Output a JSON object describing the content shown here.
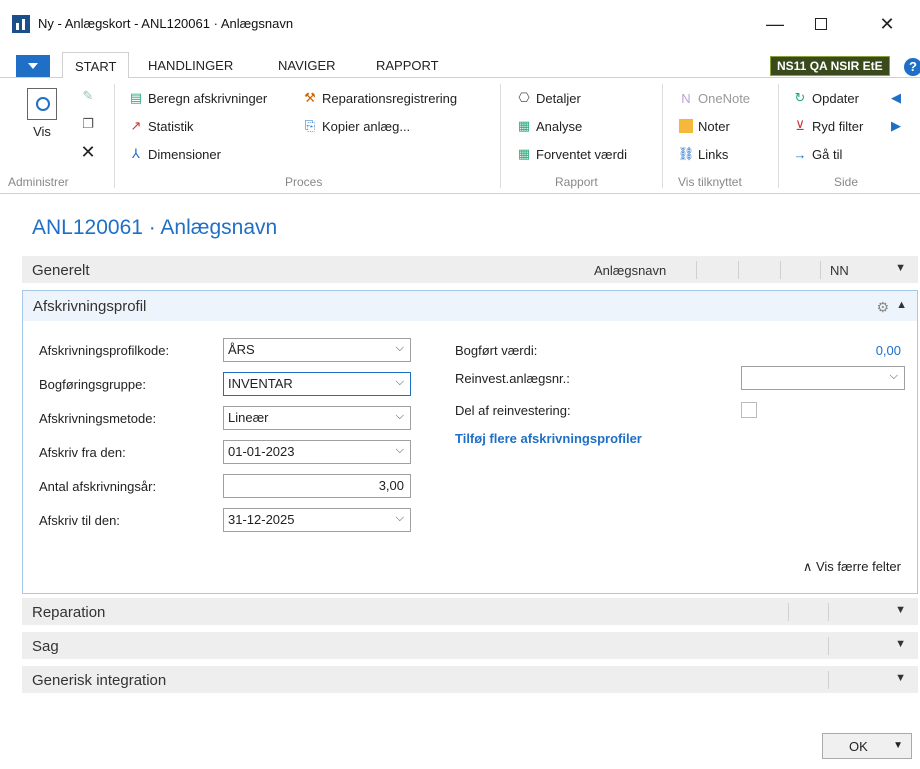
{
  "window": {
    "title": "Ny - Anlægskort - ANL120061 · Anlægsnavn",
    "minimize": "—",
    "close": "✕"
  },
  "tabs": [
    "START",
    "HANDLINGER",
    "NAVIGER",
    "RAPPORT"
  ],
  "company_badge": "NS11 QA NSIR EtE",
  "help": "?",
  "ribbon": {
    "groups": [
      "Administrer",
      "Proces",
      "Rapport",
      "Vis tilknyttet",
      "Side"
    ],
    "vis": "Vis",
    "proces": [
      "Beregn afskrivninger",
      "Statistik",
      "Dimensioner",
      "Reparationsregistrering",
      "Kopier anlæg..."
    ],
    "rapport": [
      "Detaljer",
      "Analyse",
      "Forventet værdi"
    ],
    "vis_tilknyttet": [
      "OneNote",
      "Noter",
      "Links"
    ],
    "side": [
      "Opdater",
      "Ryd filter",
      "Gå til"
    ]
  },
  "page_title": "ANL120061 · Anlægsnavn",
  "fasttabs": {
    "generelt": {
      "label": "Generelt",
      "info": "Anlægsnavn",
      "info2": "NN"
    },
    "afskrivningsprofil": {
      "label": "Afskrivningsprofil"
    },
    "reparation": {
      "label": "Reparation"
    },
    "sag": {
      "label": "Sag"
    },
    "generisk": {
      "label": "Generisk integration"
    }
  },
  "fields": {
    "afskrivningsprofilkode": {
      "label": "Afskrivningsprofilkode:",
      "value": "ÅRS"
    },
    "bogforingsgruppe": {
      "label": "Bogføringsgruppe:",
      "value": "INVENTAR"
    },
    "afskrivningsmetode": {
      "label": "Afskrivningsmetode:",
      "value": "Lineær"
    },
    "afskriv_fra": {
      "label": "Afskriv fra den:",
      "value": "01-01-2023"
    },
    "antal_aar": {
      "label": "Antal afskrivningsår:",
      "value": "3,00"
    },
    "afskriv_til": {
      "label": "Afskriv til den:",
      "value": "31-12-2025"
    },
    "bogfort_vaerdi": {
      "label": "Bogført værdi:",
      "value": "0,00"
    },
    "reinvest": {
      "label": "Reinvest.anlægsnr.:",
      "value": ""
    },
    "del_af_reinvestering": {
      "label": "Del af reinvestering:",
      "checked": false
    }
  },
  "add_profiles_link": "Tilføj flere afskrivningsprofiler",
  "fewer_fields": "Vis færre felter",
  "ok": "OK"
}
